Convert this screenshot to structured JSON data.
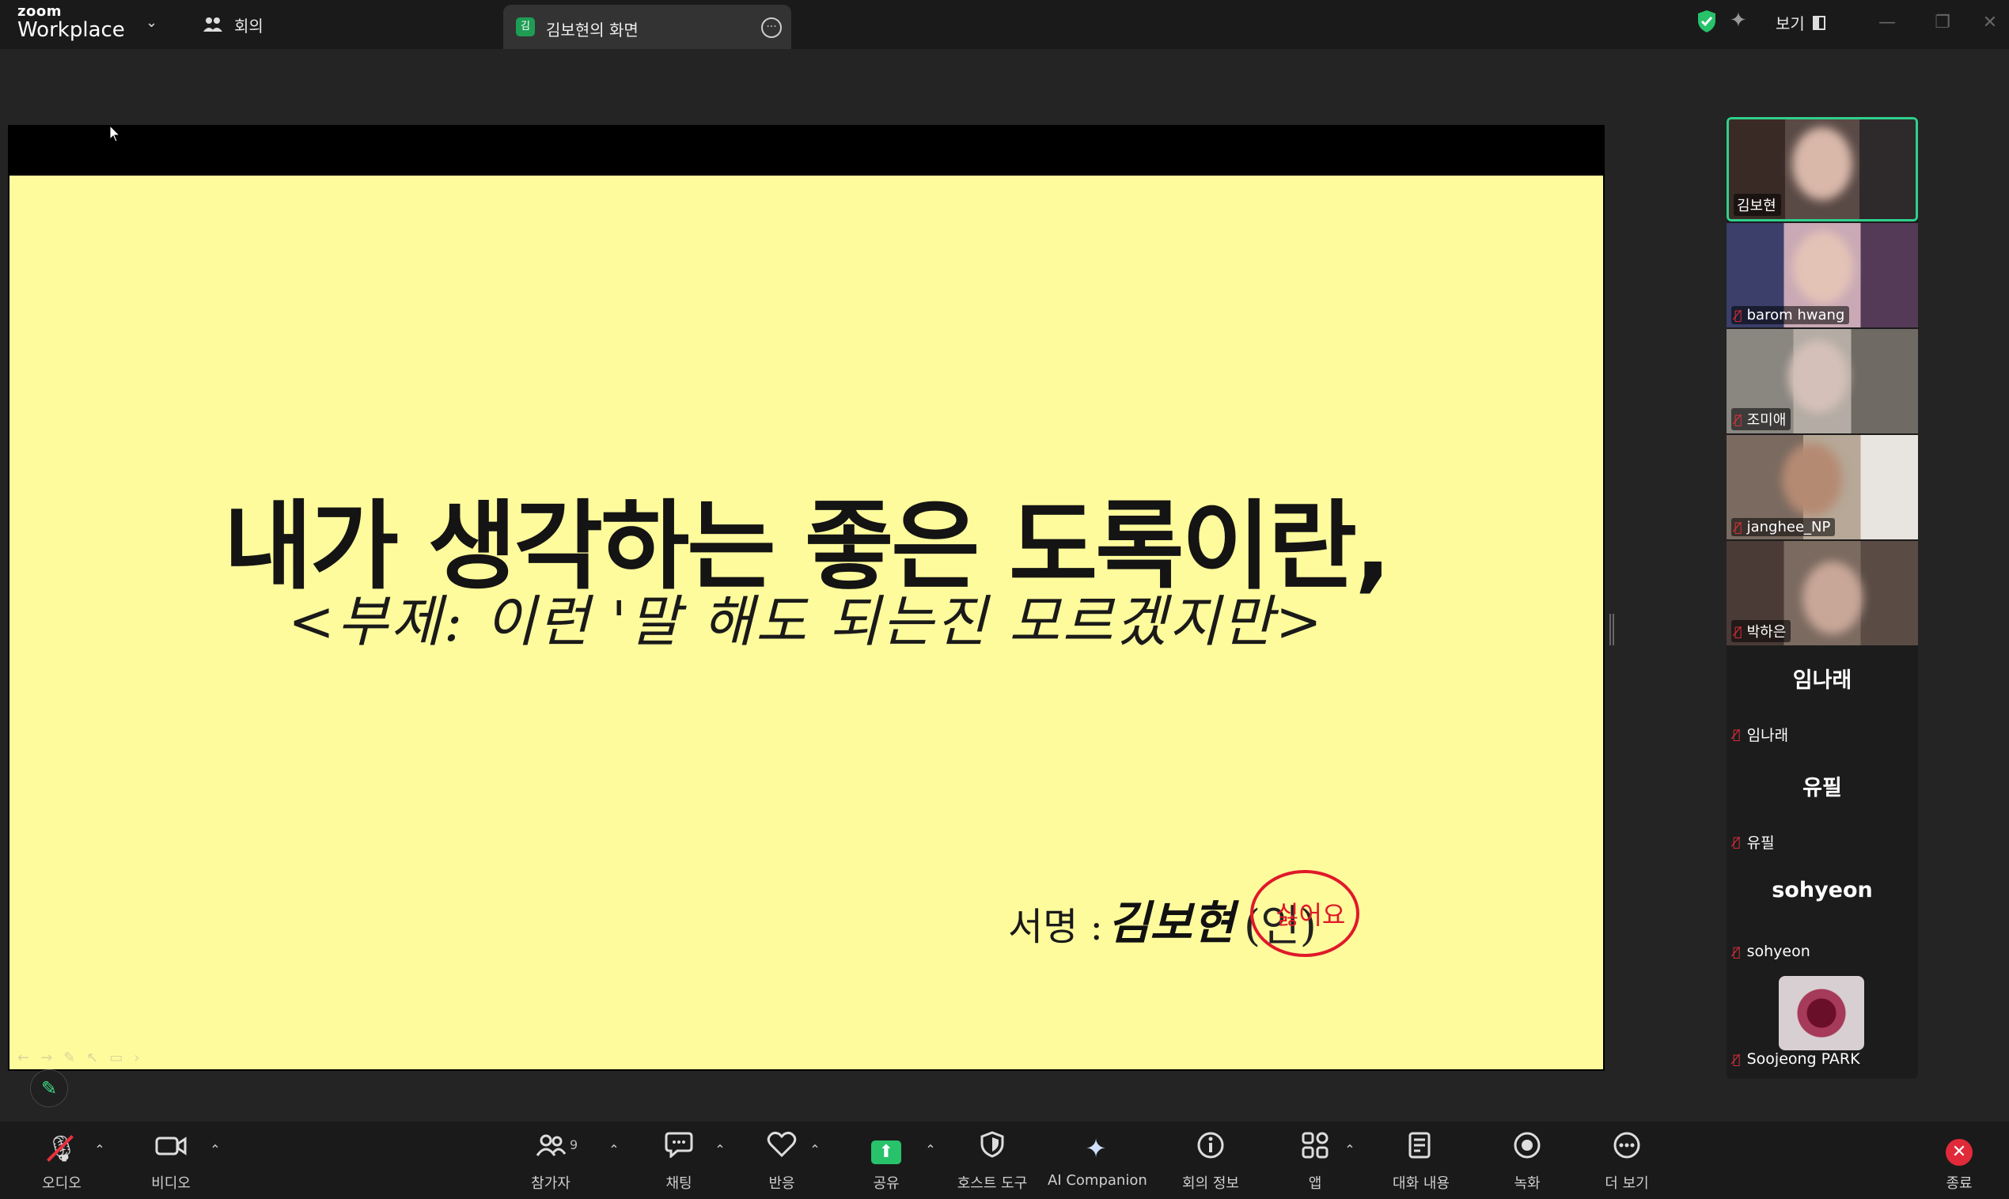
{
  "window": {
    "brand_small": "zoom",
    "brand_large": "Workplace",
    "meeting_tab": "회의",
    "share_tab": {
      "badge": "김",
      "label": "김보현의 화면"
    },
    "view_label": "보기"
  },
  "slide": {
    "title": "내가 생각하는 좋은 도록이란,",
    "subtitle": "<부제: 이런 '말 해도 되는진 모르겠지만>",
    "signature_label": "서명 :",
    "signature_name": "김보현",
    "stamp_paren": "(인)",
    "stamp_text": "싫어요"
  },
  "participants": {
    "video": [
      {
        "name": "김보현",
        "muted": false,
        "active": true
      },
      {
        "name": "barom hwang",
        "muted": true
      },
      {
        "name": "조미애",
        "muted": true
      },
      {
        "name": "janghee_NP",
        "muted": true
      },
      {
        "name": "박하은",
        "muted": true
      }
    ],
    "named": [
      {
        "big": "임나래",
        "small": "임나래"
      },
      {
        "big": "유필",
        "small": "유필"
      },
      {
        "big": "sohyeon",
        "small": "sohyeon"
      }
    ],
    "last": {
      "name": "Soojeong PARK"
    }
  },
  "toolbar": {
    "audio": "오디오",
    "video": "비디오",
    "participants": "참가자",
    "participant_count": "9",
    "chat": "채팅",
    "reactions": "반응",
    "share": "공유",
    "host_tools": "호스트 도구",
    "ai_companion": "AI Companion",
    "meeting_info": "회의 정보",
    "apps": "앱",
    "transcript": "대화 내용",
    "record": "녹화",
    "more": "더 보기",
    "end": "종료"
  },
  "colors": {
    "slide_bg": "#fefb9c",
    "active_border": "#2fd08c",
    "share_green": "#27c26a",
    "end_red": "#e02a3a"
  }
}
